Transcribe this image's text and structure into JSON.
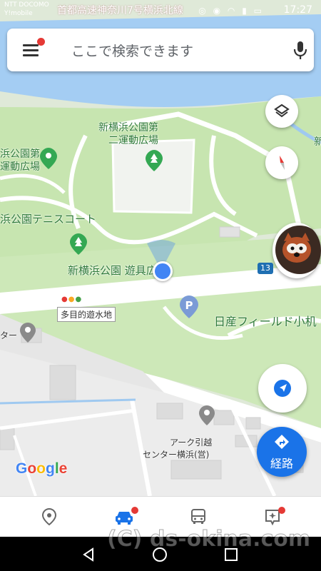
{
  "status_bar": {
    "carrier_line1": "NTT DOCOMO",
    "carrier_line2": "Y!mobile",
    "road_text": "首都高速神奈川7号横浜北線",
    "time": "17:27"
  },
  "search": {
    "placeholder": "ここで検索できます"
  },
  "map_labels": {
    "field2_line1": "新横浜公園第",
    "field2_line2": "二運動広場",
    "field1_line1": "浜公園第",
    "field1_line2": "運動広場",
    "tennis": "浜公園テニスコート",
    "playground": "新横浜公園 遊具広場",
    "reservoir": "多目的遊水地",
    "center_cut": "ター",
    "nissan": "日産フィールド小机",
    "ark_line1": "アーク引越",
    "ark_line2": "センター横浜(営)",
    "road_number": "13",
    "edge_label": "新"
  },
  "branding": {
    "google": [
      "G",
      "o",
      "o",
      "g",
      "l",
      "e"
    ],
    "google_colors": [
      "#4285F4",
      "#EA4335",
      "#FBBC05",
      "#4285F4",
      "#34A853",
      "#EA4335"
    ]
  },
  "buttons": {
    "route_label": "経路"
  },
  "bottom_nav": {
    "items": [
      "explore",
      "driving",
      "transit",
      "for-you"
    ],
    "active": "driving"
  },
  "watermark": "(C) ds-okina.com",
  "colors": {
    "accent": "#1a73e8",
    "badge": "#e53935",
    "park_green": "#c8e6b4",
    "water": "#9fc9f0"
  }
}
